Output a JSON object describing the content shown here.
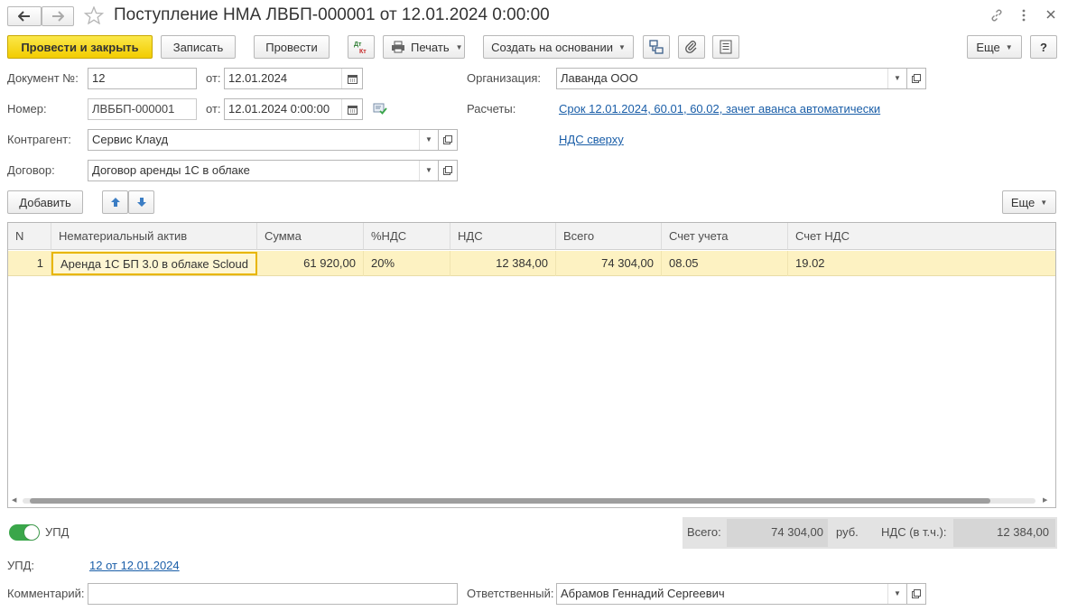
{
  "title": "Поступление НМА ЛВБП-000001 от 12.01.2024 0:00:00",
  "toolbar": {
    "post_close": "Провести и закрыть",
    "save": "Записать",
    "post": "Провести",
    "print": "Печать",
    "create_based": "Создать на основании",
    "more": "Еще",
    "help": "?"
  },
  "fields": {
    "doc_no_label": "Документ №:",
    "doc_no_value": "12",
    "from_label": "от:",
    "doc_date": "12.01.2024",
    "number_label": "Номер:",
    "number_value": "ЛВББП-000001",
    "number_date": "12.01.2024  0:00:00",
    "contractor_label": "Контрагент:",
    "contractor_value": "Сервис Клауд",
    "contract_label": "Договор:",
    "contract_value": "Договор аренды 1С в облаке",
    "org_label": "Организация:",
    "org_value": "Лаванда ООО",
    "settlements_label": "Расчеты:",
    "settlements_link": "Срок 12.01.2024, 60.01, 60.02, зачет аванса автоматически",
    "vat_link": "НДС сверху"
  },
  "table_toolbar": {
    "add": "Добавить",
    "more": "Еще"
  },
  "table": {
    "columns": [
      "N",
      "Нематериальный актив",
      "Сумма",
      "%НДС",
      "НДС",
      "Всего",
      "Счет учета",
      "Счет НДС"
    ],
    "rows": [
      {
        "n": "1",
        "asset": "Аренда 1С БП 3.0 в облаке Scloud",
        "sum": "61 920,00",
        "vat_rate": "20%",
        "vat": "12 384,00",
        "total": "74 304,00",
        "account": "08.05",
        "vat_account": "19.02"
      }
    ]
  },
  "footer": {
    "upd_toggle_label": "УПД",
    "total_label": "Всего:",
    "total_value": "74 304,00",
    "currency": "руб.",
    "vat_label": "НДС (в т.ч.):",
    "vat_value": "12 384,00",
    "upd_label": "УПД:",
    "upd_link": "12 от 12.01.2024",
    "comment_label": "Комментарий:",
    "comment_value": "",
    "responsible_label": "Ответственный:",
    "responsible_value": "Абрамов Геннадий Сергеевич"
  },
  "colors": {
    "primary_button": "#f5d20c",
    "selected_row": "#fdf2c2",
    "link": "#1a5ea8",
    "toggle_on": "#3aa64a"
  }
}
